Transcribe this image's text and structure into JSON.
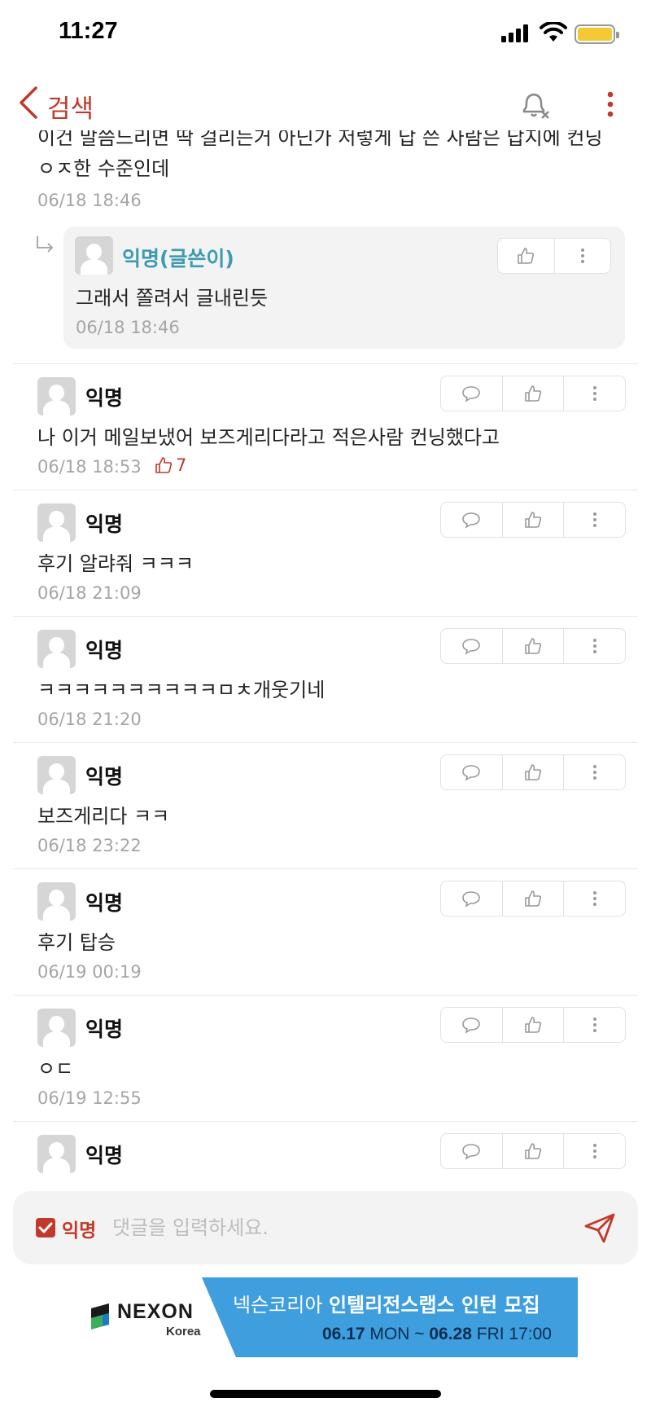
{
  "status_bar": {
    "time": "11:27"
  },
  "nav": {
    "back_label": "검색"
  },
  "previous_comment": {
    "text": "이건 말씀느리면 딱 걸리는거 아닌가 저렇게 답 쓴 사람은 답지에 컨닝 ㅇㅈ한 수준인데",
    "date": "06/18 18:46"
  },
  "reply": {
    "author": "익명(글쓴이)",
    "text": "그래서 쫄려서 글내린듯",
    "date": "06/18 18:46"
  },
  "comments": [
    {
      "author": "익명",
      "text": "나 이거 메일보냈어 보즈게리다라고 적은사람 컨닝했다고",
      "date": "06/18 18:53",
      "likes": "7"
    },
    {
      "author": "익명",
      "text": "후기 알랴줘 ㅋㅋㅋ",
      "date": "06/18 21:09"
    },
    {
      "author": "익명",
      "text": "ㅋㅋㅋㅋㅋㅋㅋㅋㅋㅋㅁㅊ개웃기네",
      "date": "06/18 21:20"
    },
    {
      "author": "익명",
      "text": "보즈게리다 ㅋㅋ",
      "date": "06/18 23:22"
    },
    {
      "author": "익명",
      "text": "후기 탑승",
      "date": "06/19 00:19"
    },
    {
      "author": "익명",
      "text": "ㅇㄷ",
      "date": "06/19 12:55"
    },
    {
      "author": "익명",
      "text": "",
      "date": ""
    }
  ],
  "input_bar": {
    "anonymous_label": "익명",
    "placeholder": "댓글을 입력하세요."
  },
  "ad": {
    "brand": "NEXON",
    "brand_sub": "Korea",
    "line1_prefix": "넥슨코리아",
    "line1_bold": "인텔리전스랩스 인턴 모집",
    "start_date": "06.17",
    "start_day": "MON",
    "separator": "~",
    "end_date": "06.28",
    "end_day": "FRI 17:00"
  },
  "colors": {
    "accent": "#c0392b",
    "reply_author": "#3d9bb0",
    "ad_blue": "#3e9ede"
  }
}
